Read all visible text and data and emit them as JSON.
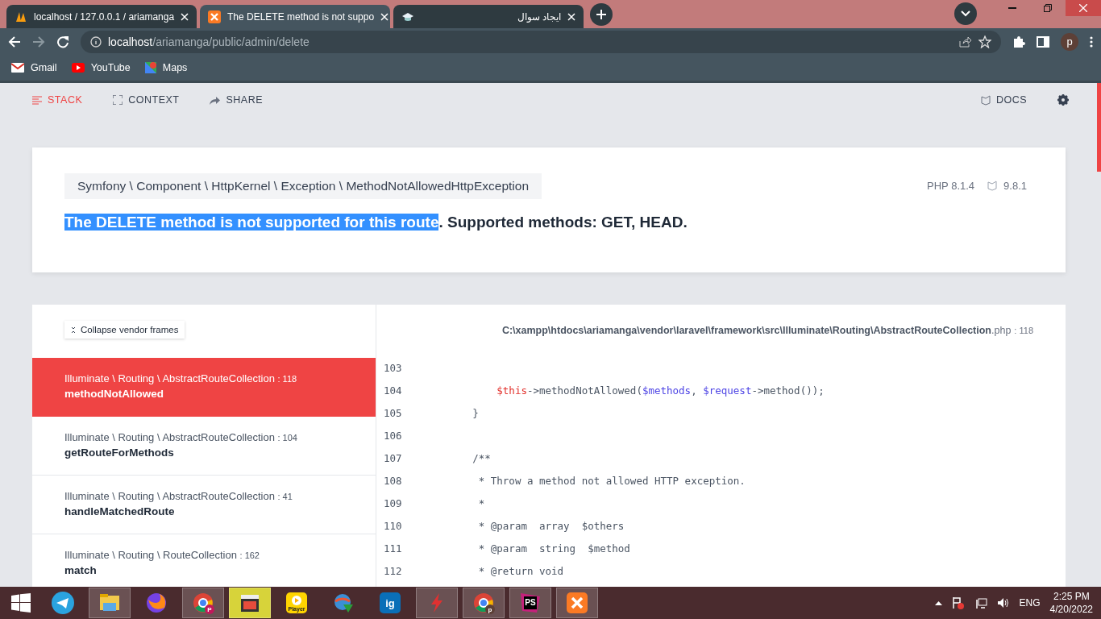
{
  "browser": {
    "tabs": [
      {
        "title": "localhost / 127.0.0.1 / ariamanga",
        "selected": false
      },
      {
        "title": "The DELETE method is not suppo",
        "selected": true
      },
      {
        "title": "ایجاد سوال",
        "selected": false
      }
    ],
    "address": {
      "host": "localhost",
      "path": "/ariamanga/public/admin/delete"
    },
    "profile_initial": "p",
    "bookmarks": [
      {
        "label": "Gmail"
      },
      {
        "label": "YouTube"
      },
      {
        "label": "Maps"
      }
    ]
  },
  "nav": {
    "items": [
      {
        "label": "STACK",
        "selected": true
      },
      {
        "label": "CONTEXT",
        "selected": false
      },
      {
        "label": "SHARE",
        "selected": false
      }
    ],
    "docs": "DOCS"
  },
  "exception": {
    "class": "Symfony \\ Component \\ HttpKernel \\ Exception \\ MethodNotAllowedHttpException",
    "php": "PHP 8.1.4",
    "laravel": "9.8.1",
    "message": [
      {
        "text": "The DELETE method is not supported for this route",
        "selected": true
      },
      {
        "text": ". Supported methods: GET, HEAD.",
        "selected": false
      }
    ]
  },
  "stack": {
    "collapse_button": "Collapse vendor frames",
    "frames": [
      {
        "class": "Illuminate \\ Routing \\ AbstractRouteCollection",
        "line": ": 118",
        "method": "methodNotAllowed",
        "selected": true
      },
      {
        "class": "Illuminate \\ Routing \\ AbstractRouteCollection",
        "line": ": 104",
        "method": "getRouteForMethods",
        "selected": false
      },
      {
        "class": "Illuminate \\ Routing \\ AbstractRouteCollection",
        "line": ": 41",
        "method": "handleMatchedRoute",
        "selected": false
      },
      {
        "class": "Illuminate \\ Routing \\ RouteCollection",
        "line": ": 162",
        "method": "match",
        "selected": false
      }
    ],
    "file": {
      "path": "C:\\xampp\\htdocs\\ariamanga\\vendor\\laravel\\framework\\src\\Illuminate\\Routing\\AbstractRouteCollection",
      "ext": ".php",
      "line": ": 118"
    },
    "code": [
      {
        "number": "103"
      },
      {
        "number": "104",
        "parts": [
          {
            "text": "            $this",
            "kind": "this"
          },
          {
            "text": "->methodNotAllowed(",
            "kind": "plain"
          },
          {
            "text": "$methods",
            "kind": "var"
          },
          {
            "text": ", ",
            "kind": "plain"
          },
          {
            "text": "$request",
            "kind": "var"
          },
          {
            "text": "->method());",
            "kind": "plain"
          }
        ]
      },
      {
        "number": "105",
        "parts": [
          {
            "text": "        }",
            "kind": "plain"
          }
        ]
      },
      {
        "number": "106"
      },
      {
        "number": "107",
        "parts": [
          {
            "text": "        /**",
            "kind": "plain"
          }
        ]
      },
      {
        "number": "108",
        "parts": [
          {
            "text": "         * Throw a method not allowed HTTP exception.",
            "kind": "plain"
          }
        ]
      },
      {
        "number": "109",
        "parts": [
          {
            "text": "         *",
            "kind": "plain"
          }
        ]
      },
      {
        "number": "110",
        "parts": [
          {
            "text": "         * @param  array  $others",
            "kind": "plain"
          }
        ]
      },
      {
        "number": "111",
        "parts": [
          {
            "text": "         * @param  string  $method",
            "kind": "plain"
          }
        ]
      },
      {
        "number": "112",
        "parts": [
          {
            "text": "         * @return void",
            "kind": "plain"
          }
        ]
      }
    ]
  },
  "taskbar": {
    "apps": [
      {
        "running": false,
        "selected": false
      },
      {
        "running": true,
        "selected": false
      },
      {
        "running": false,
        "selected": false
      },
      {
        "badge": "P",
        "running": true,
        "selected": false
      },
      {
        "running": true,
        "selected": true
      },
      {
        "label": "Player",
        "running": false,
        "selected": false
      },
      {
        "running": false,
        "selected": false
      },
      {
        "label": "ig",
        "running": false,
        "selected": false
      },
      {
        "running": true,
        "selected": false
      },
      {
        "badge": "p",
        "running": true,
        "selected": false
      },
      {
        "label": "PS",
        "running": true,
        "selected": false
      },
      {
        "running": true,
        "selected": false
      }
    ],
    "language": "ENG",
    "time": "2:25 PM",
    "date": "4/20/2022"
  }
}
